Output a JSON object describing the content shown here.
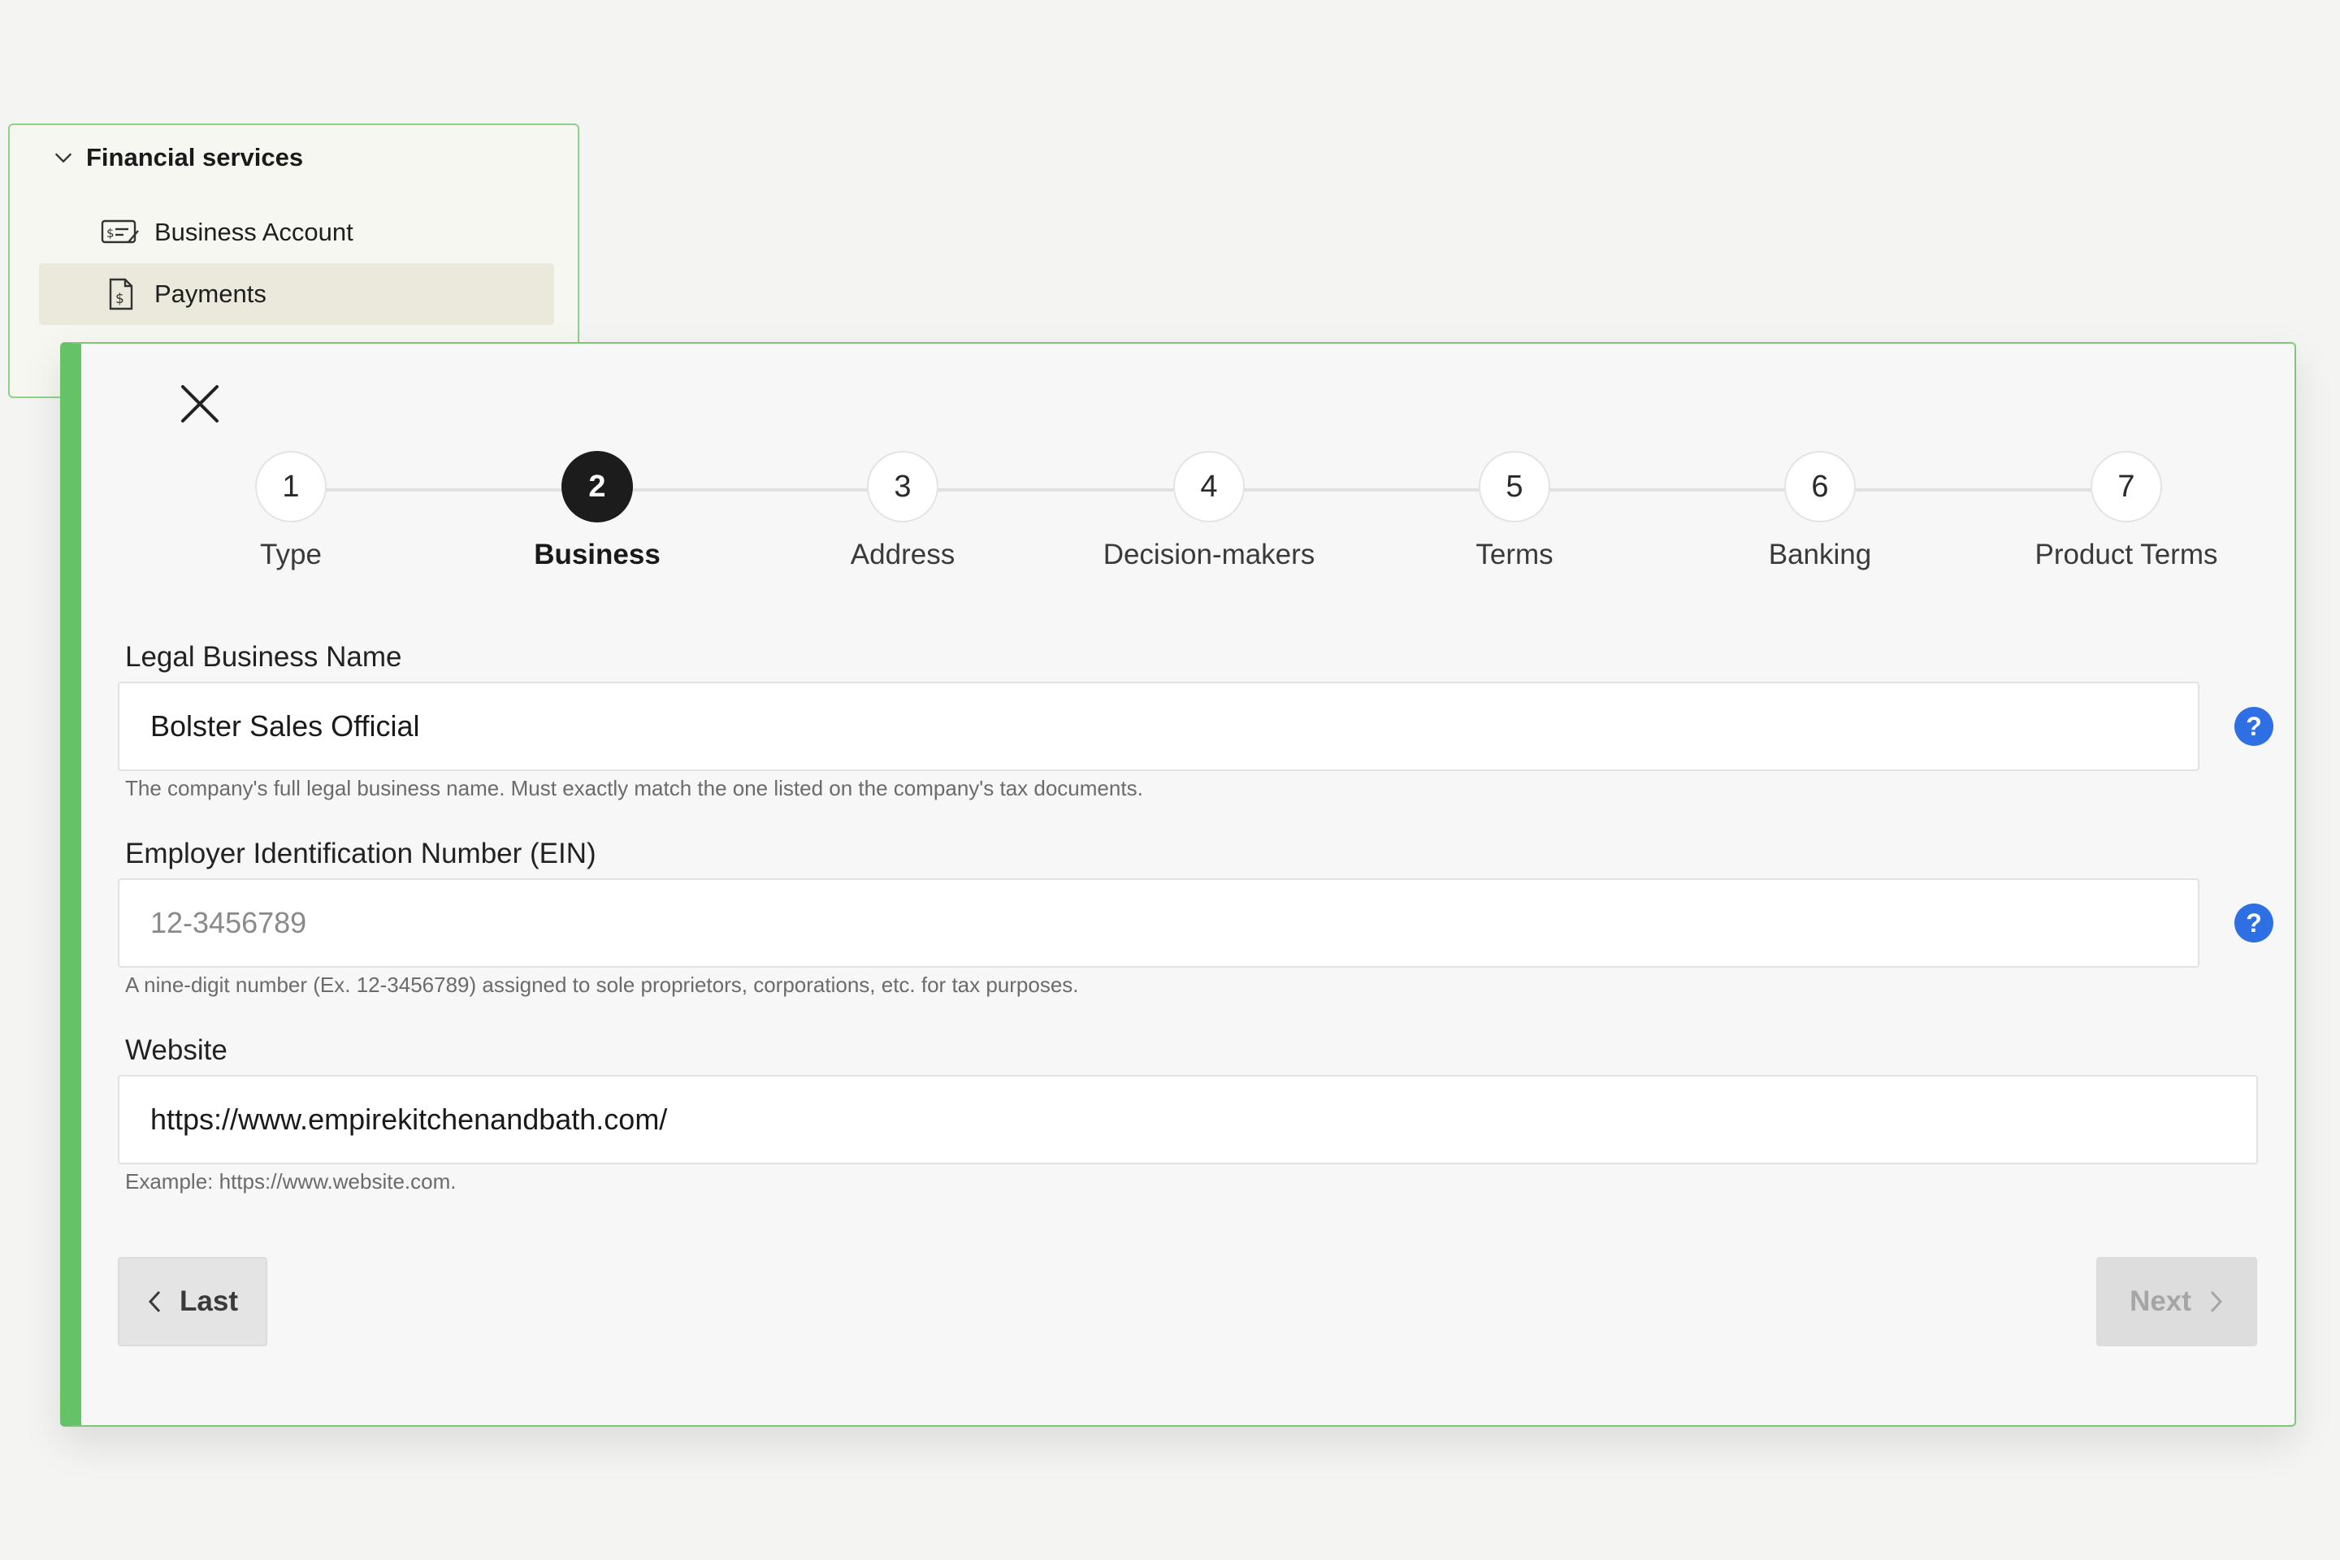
{
  "sidebar": {
    "group_label": "Financial services",
    "items": [
      {
        "label": "Business Account",
        "icon": "check-card-icon",
        "active": false
      },
      {
        "label": "Payments",
        "icon": "invoice-dollar-icon",
        "active": true
      }
    ]
  },
  "stepper": {
    "current": 2,
    "steps": [
      {
        "number": "1",
        "label": "Type"
      },
      {
        "number": "2",
        "label": "Business"
      },
      {
        "number": "3",
        "label": "Address"
      },
      {
        "number": "4",
        "label": "Decision-makers"
      },
      {
        "number": "5",
        "label": "Terms"
      },
      {
        "number": "6",
        "label": "Banking"
      },
      {
        "number": "7",
        "label": "Product Terms"
      }
    ]
  },
  "form": {
    "legal_name": {
      "label": "Legal Business Name",
      "value": "Bolster Sales Official",
      "help": "The company's full legal business name. Must exactly match the one listed on the company's tax documents."
    },
    "ein": {
      "label": "Employer Identification Number (EIN)",
      "placeholder": "12-3456789",
      "help": "A nine-digit number (Ex. 12-3456789) assigned to sole proprietors, corporations, etc. for tax purposes."
    },
    "website": {
      "label": "Website",
      "value": "https://www.empirekitchenandbath.com/",
      "help": "Example: https://www.website.com."
    }
  },
  "buttons": {
    "last": "Last",
    "next": "Next"
  },
  "help_glyph": "?",
  "colors": {
    "accent_green": "#66c266",
    "help_blue": "#2f6fe4",
    "active_step": "#1c1c1c"
  }
}
